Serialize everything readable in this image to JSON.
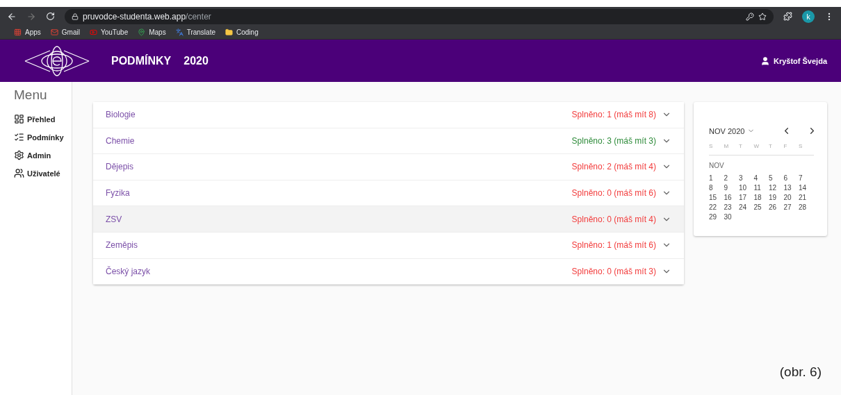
{
  "browser": {
    "url_host": "pruvodce-studenta.web.app",
    "url_path": "/center",
    "profile": "k",
    "bookmarks": [
      {
        "label": "Apps",
        "kind": "apps"
      },
      {
        "label": "Gmail",
        "kind": "mail"
      },
      {
        "label": "YouTube",
        "kind": "video"
      },
      {
        "label": "Maps",
        "kind": "pin"
      },
      {
        "label": "Translate",
        "kind": "translate"
      },
      {
        "label": "Coding",
        "kind": "folder"
      }
    ]
  },
  "header": {
    "title": "PODMÍNKY",
    "year": "2020",
    "user": "Kryštof Švejda"
  },
  "sidebar": {
    "title": "Menu",
    "items": [
      {
        "label": "Přehled",
        "kind": "dashboard"
      },
      {
        "label": "Podmínky",
        "kind": "checklist"
      },
      {
        "label": "Admin",
        "kind": "gear"
      },
      {
        "label": "Uživatelé",
        "kind": "people"
      }
    ]
  },
  "subjects": [
    {
      "name": "Biologie",
      "status": "Splněno: 1 (máš mít 8)",
      "met": false,
      "highlighted": false
    },
    {
      "name": "Chemie",
      "status": "Splněno: 3 (máš mít 3)",
      "met": true,
      "highlighted": false
    },
    {
      "name": "Dějepis",
      "status": "Splněno: 2 (máš mít 4)",
      "met": false,
      "highlighted": false
    },
    {
      "name": "Fyzika",
      "status": "Splněno: 0 (máš mít 6)",
      "met": false,
      "highlighted": false
    },
    {
      "name": "ZSV",
      "status": "Splněno: 0 (máš mít 4)",
      "met": false,
      "highlighted": true
    },
    {
      "name": "Zeměpis",
      "status": "Splněno: 1 (máš mít 6)",
      "met": false,
      "highlighted": false
    },
    {
      "name": "Český jazyk",
      "status": "Splněno: 0 (máš mít 3)",
      "met": false,
      "highlighted": false
    }
  ],
  "calendar": {
    "month_year": "NOV 2020",
    "weekdays": [
      "S",
      "M",
      "T",
      "W",
      "T",
      "F",
      "S"
    ],
    "month_label": "NOV",
    "days": [
      "1",
      "2",
      "3",
      "4",
      "5",
      "6",
      "7",
      "8",
      "9",
      "10",
      "11",
      "12",
      "13",
      "14",
      "15",
      "16",
      "17",
      "18",
      "19",
      "20",
      "21",
      "22",
      "23",
      "24",
      "25",
      "26",
      "27",
      "28",
      "29",
      "30"
    ]
  },
  "caption": "(obr. 6)"
}
